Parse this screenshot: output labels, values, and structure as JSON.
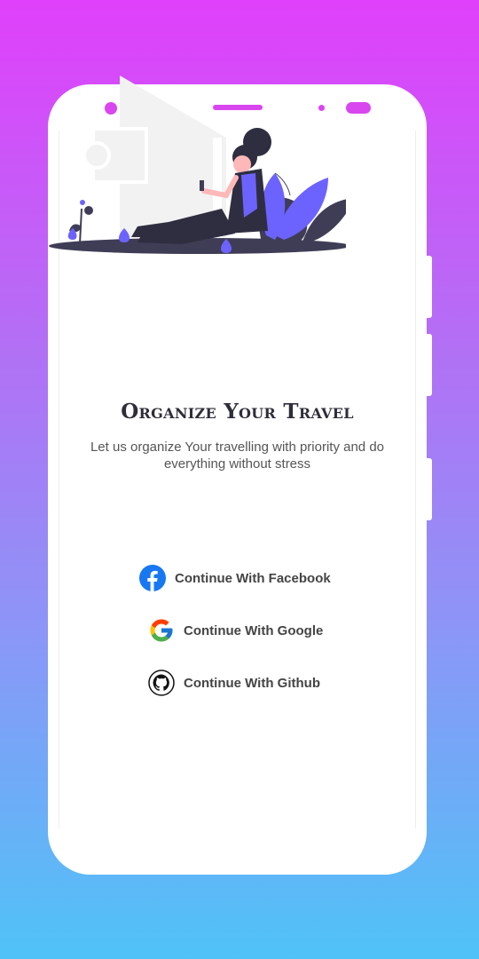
{
  "onboarding": {
    "title": "Organize Your Travel",
    "subtitle": "Let us organize Your travelling with priority and do everything without stress"
  },
  "auth": {
    "buttons": [
      {
        "label": "Continue With Facebook",
        "icon": "facebook-icon"
      },
      {
        "label": "Continue With Google",
        "icon": "google-icon"
      },
      {
        "label": "Continue With Github",
        "icon": "github-icon"
      }
    ]
  },
  "colors": {
    "gradient_top": "#e040fb",
    "gradient_bottom": "#4fc3f7",
    "accent": "#d946ef",
    "illustration_accent": "#6c63ff",
    "facebook_blue": "#1877f2"
  }
}
